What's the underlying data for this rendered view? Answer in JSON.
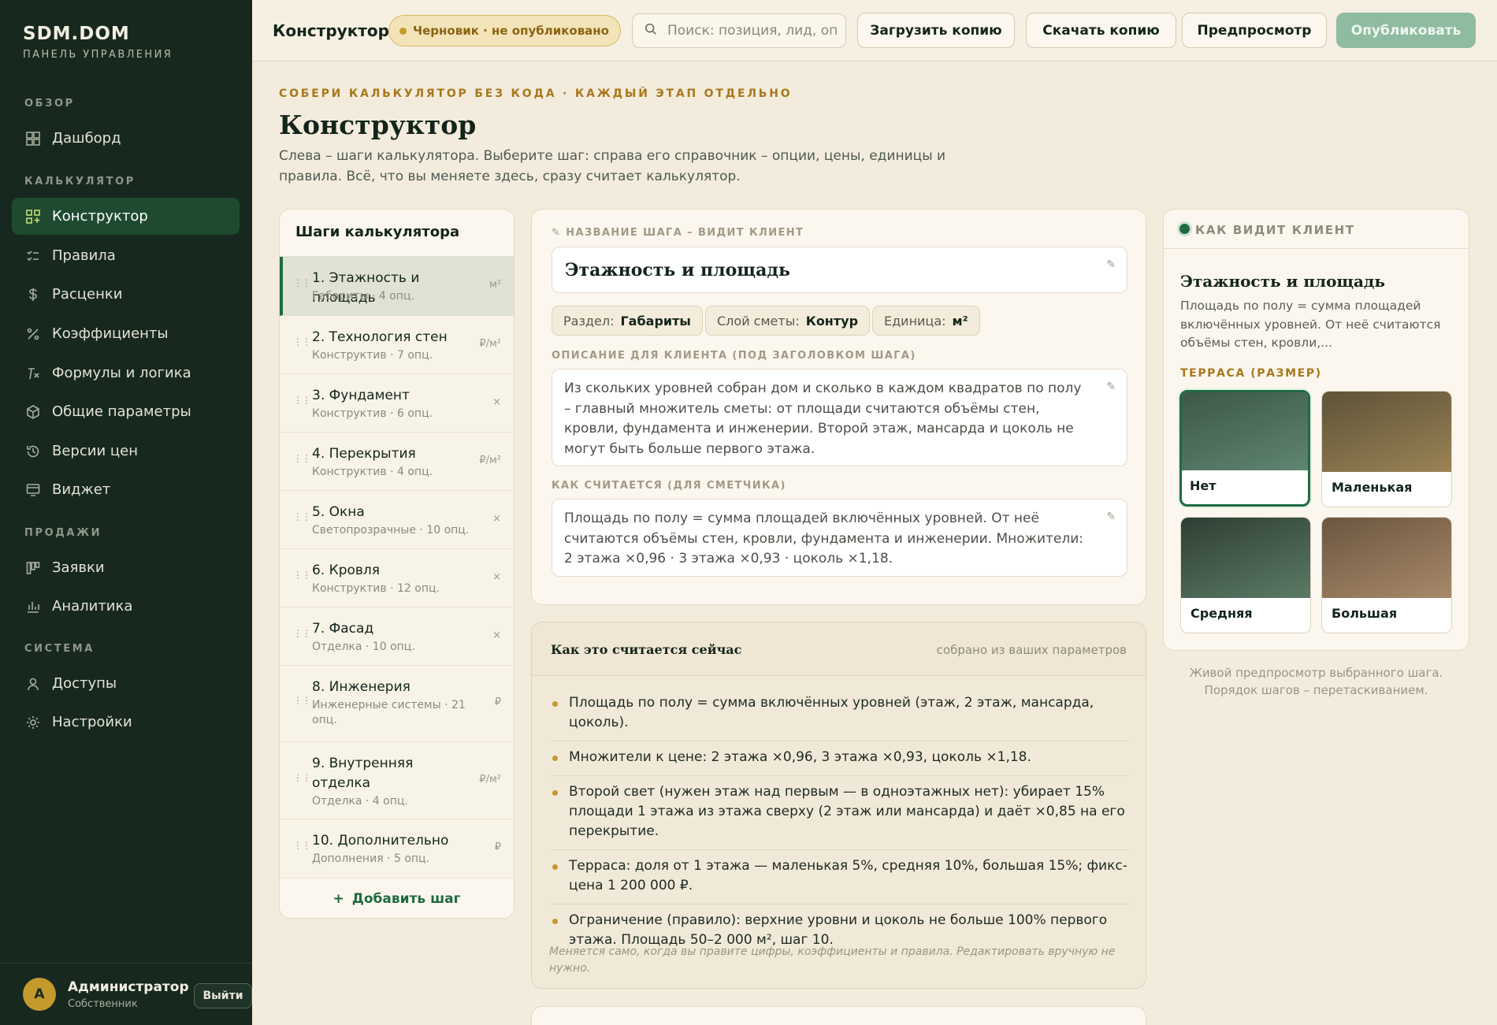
{
  "brand": {
    "title": "SDM.DOM",
    "subtitle": "ПАНЕЛЬ УПРАВЛЕНИЯ"
  },
  "sidebar": {
    "sections": [
      "ОБЗОР",
      "КАЛЬКУЛЯТОР",
      "ПРОДАЖИ",
      "СИСТЕМА"
    ],
    "items": [
      {
        "label": "Дашборд",
        "icon": "grid-icon",
        "active": false
      },
      {
        "label": "Конструктор",
        "icon": "builder-icon",
        "active": true
      },
      {
        "label": "Правила",
        "icon": "rules-icon",
        "active": false
      },
      {
        "label": "Расценки",
        "icon": "dollar-icon",
        "active": false
      },
      {
        "label": "Коэффициенты",
        "icon": "percent-icon",
        "active": false
      },
      {
        "label": "Формулы и логика",
        "icon": "formula-icon",
        "active": false
      },
      {
        "label": "Общие параметры",
        "icon": "cube-icon",
        "active": false
      },
      {
        "label": "Версии цен",
        "icon": "history-icon",
        "active": false
      },
      {
        "label": "Виджет",
        "icon": "widget-icon",
        "active": false
      },
      {
        "label": "Заявки",
        "icon": "kanban-icon",
        "active": false
      },
      {
        "label": "Аналитика",
        "icon": "bar-chart-icon",
        "active": false
      },
      {
        "label": "Доступы",
        "icon": "user-icon",
        "active": false
      },
      {
        "label": "Настройки",
        "icon": "gear-icon",
        "active": false
      }
    ],
    "user": {
      "initial": "А",
      "name": "Администратор",
      "role": "Собственник",
      "logout": "Выйти"
    }
  },
  "topbar": {
    "title": "Конструктор",
    "badge": "Черновик · не опубликовано",
    "search_placeholder": "Поиск: позиция, лид, опция",
    "upload": "Загрузить копию",
    "download": "Скачать копию",
    "preview": "Предпросмотр",
    "publish": "Опубликовать"
  },
  "header": {
    "eyebrow": "СОБЕРИ КАЛЬКУЛЯТОР БЕЗ КОДА · КАЖДЫЙ ЭТАП ОТДЕЛЬНО",
    "title": "Конструктор",
    "description": "Слева – шаги калькулятора. Выберите шаг: справа его справочник – опции, цены, единицы и правила. Всё, что вы меняете здесь, сразу считает калькулятор."
  },
  "steps": {
    "title": "Шаги калькулятора",
    "add": "Добавить шаг",
    "items": [
      {
        "name": "1. Этажность и площадь",
        "meta": "Габариты · 4 опц.",
        "unit": "м²"
      },
      {
        "name": "2. Технология стен",
        "meta": "Конструктив · 7 опц.",
        "unit": "₽/м²"
      },
      {
        "name": "3. Фундамент",
        "meta": "Конструктив · 6 опц.",
        "unit": "×"
      },
      {
        "name": "4. Перекрытия",
        "meta": "Конструктив · 4 опц.",
        "unit": "₽/м²"
      },
      {
        "name": "5. Окна",
        "meta": "Светопрозрачные · 10 опц.",
        "unit": "×"
      },
      {
        "name": "6. Кровля",
        "meta": "Конструктив · 12 опц.",
        "unit": "×"
      },
      {
        "name": "7. Фасад",
        "meta": "Отделка · 10 опц.",
        "unit": "×"
      },
      {
        "name": "8. Инженерия",
        "meta": "Инженерные системы · 21 опц.",
        "unit": "₽"
      },
      {
        "name": "9. Внутренняя отделка",
        "meta": "Отделка · 4 опц.",
        "unit": "₽/м²"
      },
      {
        "name": "10. Дополнительно",
        "meta": "Дополнения · 5 опц.",
        "unit": "₽"
      }
    ]
  },
  "editor": {
    "name_label": "✎ НАЗВАНИЕ ШАГА – ВИДИТ КЛИЕНТ",
    "name_value": "Этажность и площадь",
    "chips": [
      {
        "key": "Раздел:",
        "value": "Габариты"
      },
      {
        "key": "Слой сметы:",
        "value": "Контур"
      },
      {
        "key": "Единица:",
        "value": "м²"
      }
    ],
    "desc_label": "ОПИСАНИЕ ДЛЯ КЛИЕНТА (ПОД ЗАГОЛОВКОМ ШАГА)",
    "desc_value": "Из скольких уровней собран дом и сколько в каждом квадратов по полу – главный множитель сметы: от площади считаются объёмы стен, кровли, фундамента и инженерии. Второй этаж, мансарда и цоколь не могут быть больше первого этажа.",
    "calc_label": "КАК СЧИТАЕТСЯ (ДЛЯ СМЕТЧИКА)",
    "calc_value": "Площадь по полу = сумма площадей включённых уровней. От неё считаются объёмы стен, кровли, фундамента и инженерии. Множители: 2 этажа ×0,96 · 3 этажа ×0,93 · цоколь ×1,18."
  },
  "calc": {
    "title": "Как это считается сейчас",
    "note": "собрано из ваших параметров",
    "items": [
      "Площадь по полу = сумма включённых уровней (этаж, 2 этаж, мансарда, цоколь).",
      "Множители к цене: 2 этажа ×0,96, 3 этажа ×0,93, цоколь ×1,18.",
      "Второй свет (нужен этаж над первым — в одноэтажных нет): убирает 15% площади 1 этажа из этажа сверху (2 этаж или мансарда) и даёт ×0,85 на его перекрытие.",
      "Терраса: доля от 1 этажа — маленькая 5%, средняя 10%, большая 15%; фикс-цена 1 200 000 ₽.",
      "Ограничение (правило): верхние уровни и цоколь не больше 100% первого этажа. Площадь 50–2 000 м², шаг 10."
    ],
    "footer": "Меняется само, когда вы правите цифры, коэффициенты и правила. Редактировать вручную не нужно."
  },
  "preview": {
    "label": "КАК ВИДИТ КЛИЕНТ",
    "title": "Этажность и площадь",
    "description": "Площадь по полу = сумма площадей включённых уровней. От неё считаются объёмы стен, кровли,...",
    "group": "ТЕРРАСА (РАЗМЕР)",
    "options": [
      {
        "label": "Нет",
        "selected": true,
        "from": "#3d5747",
        "to": "#5f8571"
      },
      {
        "label": "Маленькая",
        "selected": false,
        "from": "#5e5238",
        "to": "#9a8355"
      },
      {
        "label": "Средняя",
        "selected": false,
        "from": "#2e3f33",
        "to": "#5c7a66"
      },
      {
        "label": "Большая",
        "selected": false,
        "from": "#6b5640",
        "to": "#a8896a"
      }
    ],
    "caption": "Живой предпросмотр выбранного шага. Порядок шагов – перетаскиванием."
  },
  "colors": {
    "accent": "#1f6a3f",
    "sidebar": "#17291f",
    "gold": "#a8781c",
    "background": "#f3ecdd"
  }
}
